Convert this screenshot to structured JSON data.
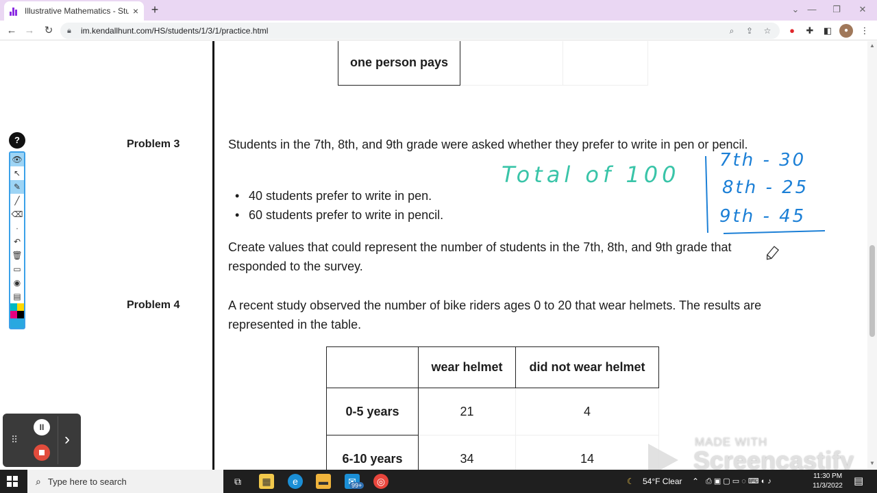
{
  "browser": {
    "tab_title": "Illustrative Mathematics - Student",
    "tab_close": "×",
    "new_tab": "+",
    "url": "im.kendallhunt.com/HS/students/1/3/1/practice.html",
    "window_controls": {
      "minimize": "—",
      "restore": "❐",
      "close": "✕"
    }
  },
  "page": {
    "top_table": {
      "row_label": "one person pays",
      "cells": [
        "",
        ""
      ]
    },
    "problem3": {
      "label": "Problem 3",
      "intro": "Students in the 7th, 8th, and 9th grade were asked whether they prefer to write in pen or pencil.",
      "bullets": [
        "40 students prefer to write in pen.",
        "60 students prefer to write in pencil."
      ],
      "task": "Create values that could represent the number of students in the 7th, 8th, and 9th grade that responded to the survey."
    },
    "problem4": {
      "label": "Problem 4",
      "intro": "A recent study observed the number of bike riders ages 0 to 20 that wear helmets. The results are represented in the table.",
      "table": {
        "headers": [
          "",
          "wear helmet",
          "did not wear helmet"
        ],
        "rows": [
          {
            "label": "0-5 years",
            "values": [
              "21",
              "4"
            ]
          },
          {
            "label": "6-10 years",
            "values": [
              "34",
              "14"
            ]
          }
        ]
      }
    }
  },
  "handwriting": {
    "total": "Total of 100",
    "lines": [
      "7th - 30",
      "8th - 25",
      "9th - 45"
    ],
    "total_color": "#39c4a8",
    "lines_color": "#1b7fd6"
  },
  "annotation_toolbar": {
    "logo": "?",
    "tools": [
      "eye-icon",
      "pointer-icon",
      "pen-icon",
      "line-icon",
      "eraser-icon",
      "dot-icon",
      "undo-icon",
      "trash-icon",
      "screen-icon",
      "camera-icon",
      "clipboard-icon"
    ],
    "colors": [
      "#00b7c3",
      "#ffd800",
      "#e6007e",
      "#000000",
      "#29a8e0"
    ]
  },
  "recorder": {
    "pause": "II",
    "next": "›"
  },
  "watermark": {
    "made_with": "MADE WITH",
    "brand": "Screencastify"
  },
  "taskbar": {
    "search_placeholder": "Type here to search",
    "badge": "99+",
    "weather": "54°F  Clear",
    "time": "11:30 PM",
    "date": "11/3/2022"
  }
}
